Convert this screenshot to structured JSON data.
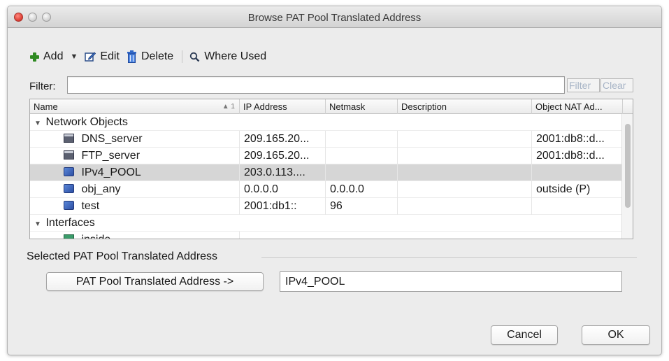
{
  "window": {
    "title": "Browse PAT Pool Translated Address"
  },
  "toolbar": {
    "add_label": "Add",
    "edit_label": "Edit",
    "delete_label": "Delete",
    "where_used_label": "Where Used"
  },
  "filter": {
    "label": "Filter:",
    "value": "",
    "filter_button": "Filter",
    "clear_button": "Clear"
  },
  "table": {
    "columns": [
      "Name",
      "IP Address",
      "Netmask",
      "Description",
      "Object NAT Ad..."
    ],
    "sort_indicator": "▲ 1",
    "groups": [
      {
        "label": "Network Objects",
        "rows": [
          {
            "name": "DNS_server",
            "ip": "209.165.20...",
            "netmask": "",
            "description": "",
            "object_nat": "2001:db8::d...",
            "icon": "server-icon"
          },
          {
            "name": "FTP_server",
            "ip": "209.165.20...",
            "netmask": "",
            "description": "",
            "object_nat": "2001:db8::d...",
            "icon": "server-icon"
          },
          {
            "name": "IPv4_POOL",
            "ip": "203.0.113....",
            "netmask": "",
            "description": "",
            "object_nat": "",
            "icon": "network-object-icon",
            "selected": true
          },
          {
            "name": "obj_any",
            "ip": "0.0.0.0",
            "netmask": "0.0.0.0",
            "description": "",
            "object_nat": "outside (P)",
            "icon": "network-object-icon"
          },
          {
            "name": "test",
            "ip": "2001:db1::",
            "netmask": "96",
            "description": "",
            "object_nat": "",
            "icon": "network-object-icon"
          }
        ]
      },
      {
        "label": "Interfaces",
        "rows": [
          {
            "name": "inside",
            "icon": "interface-icon"
          }
        ]
      }
    ]
  },
  "selection": {
    "section_label": "Selected PAT Pool Translated Address",
    "button_label": "PAT Pool Translated Address ->",
    "value": "IPv4_POOL"
  },
  "footer": {
    "cancel_label": "Cancel",
    "ok_label": "OK"
  }
}
